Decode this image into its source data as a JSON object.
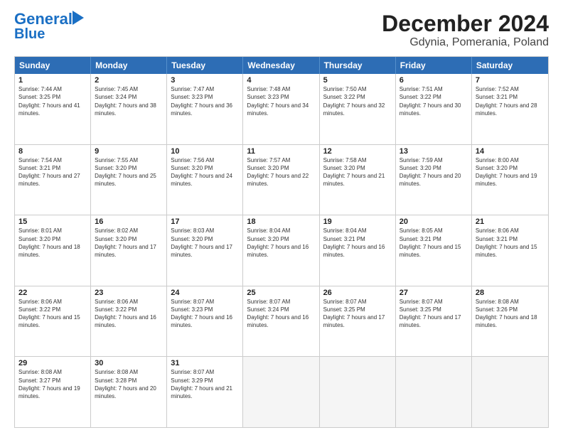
{
  "logo": {
    "line1": "General",
    "line2": "Blue"
  },
  "title": "December 2024",
  "subtitle": "Gdynia, Pomerania, Poland",
  "days": [
    "Sunday",
    "Monday",
    "Tuesday",
    "Wednesday",
    "Thursday",
    "Friday",
    "Saturday"
  ],
  "weeks": [
    [
      {
        "day": "1",
        "sunrise": "Sunrise: 7:44 AM",
        "sunset": "Sunset: 3:25 PM",
        "daylight": "Daylight: 7 hours and 41 minutes."
      },
      {
        "day": "2",
        "sunrise": "Sunrise: 7:45 AM",
        "sunset": "Sunset: 3:24 PM",
        "daylight": "Daylight: 7 hours and 38 minutes."
      },
      {
        "day": "3",
        "sunrise": "Sunrise: 7:47 AM",
        "sunset": "Sunset: 3:23 PM",
        "daylight": "Daylight: 7 hours and 36 minutes."
      },
      {
        "day": "4",
        "sunrise": "Sunrise: 7:48 AM",
        "sunset": "Sunset: 3:23 PM",
        "daylight": "Daylight: 7 hours and 34 minutes."
      },
      {
        "day": "5",
        "sunrise": "Sunrise: 7:50 AM",
        "sunset": "Sunset: 3:22 PM",
        "daylight": "Daylight: 7 hours and 32 minutes."
      },
      {
        "day": "6",
        "sunrise": "Sunrise: 7:51 AM",
        "sunset": "Sunset: 3:22 PM",
        "daylight": "Daylight: 7 hours and 30 minutes."
      },
      {
        "day": "7",
        "sunrise": "Sunrise: 7:52 AM",
        "sunset": "Sunset: 3:21 PM",
        "daylight": "Daylight: 7 hours and 28 minutes."
      }
    ],
    [
      {
        "day": "8",
        "sunrise": "Sunrise: 7:54 AM",
        "sunset": "Sunset: 3:21 PM",
        "daylight": "Daylight: 7 hours and 27 minutes."
      },
      {
        "day": "9",
        "sunrise": "Sunrise: 7:55 AM",
        "sunset": "Sunset: 3:20 PM",
        "daylight": "Daylight: 7 hours and 25 minutes."
      },
      {
        "day": "10",
        "sunrise": "Sunrise: 7:56 AM",
        "sunset": "Sunset: 3:20 PM",
        "daylight": "Daylight: 7 hours and 24 minutes."
      },
      {
        "day": "11",
        "sunrise": "Sunrise: 7:57 AM",
        "sunset": "Sunset: 3:20 PM",
        "daylight": "Daylight: 7 hours and 22 minutes."
      },
      {
        "day": "12",
        "sunrise": "Sunrise: 7:58 AM",
        "sunset": "Sunset: 3:20 PM",
        "daylight": "Daylight: 7 hours and 21 minutes."
      },
      {
        "day": "13",
        "sunrise": "Sunrise: 7:59 AM",
        "sunset": "Sunset: 3:20 PM",
        "daylight": "Daylight: 7 hours and 20 minutes."
      },
      {
        "day": "14",
        "sunrise": "Sunrise: 8:00 AM",
        "sunset": "Sunset: 3:20 PM",
        "daylight": "Daylight: 7 hours and 19 minutes."
      }
    ],
    [
      {
        "day": "15",
        "sunrise": "Sunrise: 8:01 AM",
        "sunset": "Sunset: 3:20 PM",
        "daylight": "Daylight: 7 hours and 18 minutes."
      },
      {
        "day": "16",
        "sunrise": "Sunrise: 8:02 AM",
        "sunset": "Sunset: 3:20 PM",
        "daylight": "Daylight: 7 hours and 17 minutes."
      },
      {
        "day": "17",
        "sunrise": "Sunrise: 8:03 AM",
        "sunset": "Sunset: 3:20 PM",
        "daylight": "Daylight: 7 hours and 17 minutes."
      },
      {
        "day": "18",
        "sunrise": "Sunrise: 8:04 AM",
        "sunset": "Sunset: 3:20 PM",
        "daylight": "Daylight: 7 hours and 16 minutes."
      },
      {
        "day": "19",
        "sunrise": "Sunrise: 8:04 AM",
        "sunset": "Sunset: 3:21 PM",
        "daylight": "Daylight: 7 hours and 16 minutes."
      },
      {
        "day": "20",
        "sunrise": "Sunrise: 8:05 AM",
        "sunset": "Sunset: 3:21 PM",
        "daylight": "Daylight: 7 hours and 15 minutes."
      },
      {
        "day": "21",
        "sunrise": "Sunrise: 8:06 AM",
        "sunset": "Sunset: 3:21 PM",
        "daylight": "Daylight: 7 hours and 15 minutes."
      }
    ],
    [
      {
        "day": "22",
        "sunrise": "Sunrise: 8:06 AM",
        "sunset": "Sunset: 3:22 PM",
        "daylight": "Daylight: 7 hours and 15 minutes."
      },
      {
        "day": "23",
        "sunrise": "Sunrise: 8:06 AM",
        "sunset": "Sunset: 3:22 PM",
        "daylight": "Daylight: 7 hours and 16 minutes."
      },
      {
        "day": "24",
        "sunrise": "Sunrise: 8:07 AM",
        "sunset": "Sunset: 3:23 PM",
        "daylight": "Daylight: 7 hours and 16 minutes."
      },
      {
        "day": "25",
        "sunrise": "Sunrise: 8:07 AM",
        "sunset": "Sunset: 3:24 PM",
        "daylight": "Daylight: 7 hours and 16 minutes."
      },
      {
        "day": "26",
        "sunrise": "Sunrise: 8:07 AM",
        "sunset": "Sunset: 3:25 PM",
        "daylight": "Daylight: 7 hours and 17 minutes."
      },
      {
        "day": "27",
        "sunrise": "Sunrise: 8:07 AM",
        "sunset": "Sunset: 3:25 PM",
        "daylight": "Daylight: 7 hours and 17 minutes."
      },
      {
        "day": "28",
        "sunrise": "Sunrise: 8:08 AM",
        "sunset": "Sunset: 3:26 PM",
        "daylight": "Daylight: 7 hours and 18 minutes."
      }
    ],
    [
      {
        "day": "29",
        "sunrise": "Sunrise: 8:08 AM",
        "sunset": "Sunset: 3:27 PM",
        "daylight": "Daylight: 7 hours and 19 minutes."
      },
      {
        "day": "30",
        "sunrise": "Sunrise: 8:08 AM",
        "sunset": "Sunset: 3:28 PM",
        "daylight": "Daylight: 7 hours and 20 minutes."
      },
      {
        "day": "31",
        "sunrise": "Sunrise: 8:07 AM",
        "sunset": "Sunset: 3:29 PM",
        "daylight": "Daylight: 7 hours and 21 minutes."
      },
      null,
      null,
      null,
      null
    ]
  ]
}
